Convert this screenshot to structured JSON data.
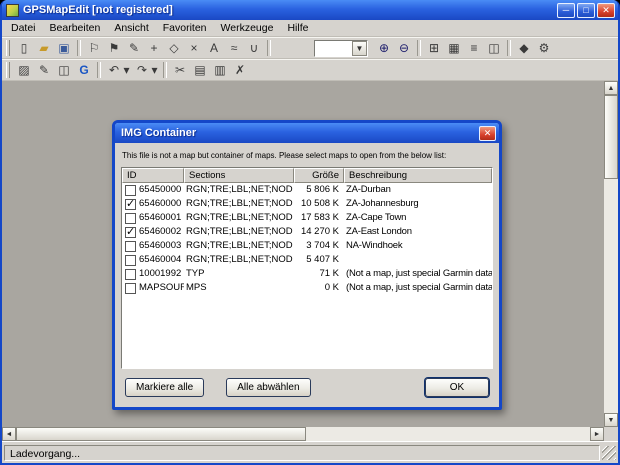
{
  "window": {
    "title": "GPSMapEdit [not registered]",
    "min_glyph": "─",
    "max_glyph": "□",
    "close_glyph": "✕"
  },
  "menubar": {
    "items": [
      "Datei",
      "Bearbeiten",
      "Ansicht",
      "Favoriten",
      "Werkzeuge",
      "Hilfe"
    ]
  },
  "toolbars": {
    "row1a": [
      {
        "name": "new-file-icon",
        "glyph": "▯"
      },
      {
        "name": "open-file-icon",
        "glyph": "▰"
      },
      {
        "name": "save-icon",
        "glyph": "▣"
      },
      {
        "name": "separator",
        "glyph": ""
      },
      {
        "name": "add-waypoint-icon",
        "glyph": "⚐"
      },
      {
        "name": "add-flag-icon",
        "glyph": "⚑"
      },
      {
        "name": "draw-polyline-icon",
        "glyph": "✎"
      },
      {
        "name": "add-node-icon",
        "glyph": "+"
      },
      {
        "name": "move-vertex-icon",
        "glyph": "◇"
      },
      {
        "name": "erase-icon",
        "glyph": "×"
      },
      {
        "name": "label-icon",
        "glyph": "A"
      },
      {
        "name": "route-icon",
        "glyph": "≈"
      },
      {
        "name": "magnet-icon",
        "glyph": "∪"
      },
      {
        "name": "separator",
        "glyph": ""
      }
    ],
    "scale_combo_value": "",
    "row1b": [
      {
        "name": "zoom-in-icon",
        "glyph": "⊕"
      },
      {
        "name": "zoom-out-icon",
        "glyph": "⊖"
      },
      {
        "name": "separator",
        "glyph": ""
      },
      {
        "name": "grid-icon",
        "glyph": "⊞"
      },
      {
        "name": "mesh-icon",
        "glyph": "▦"
      },
      {
        "name": "layers-icon",
        "glyph": "≡"
      },
      {
        "name": "tiles-icon",
        "glyph": "◫"
      },
      {
        "name": "separator",
        "glyph": ""
      },
      {
        "name": "objects-icon",
        "glyph": "◆"
      },
      {
        "name": "settings-icon",
        "glyph": "⚙"
      }
    ],
    "row2": [
      {
        "name": "hatch-icon",
        "glyph": "▨"
      },
      {
        "name": "pencil-icon",
        "glyph": "✎"
      },
      {
        "name": "overlay-icon",
        "glyph": "◫"
      },
      {
        "name": "google-earth-icon",
        "glyph": "G"
      },
      {
        "name": "separator",
        "glyph": ""
      },
      {
        "name": "undo-icon",
        "glyph": "↶"
      },
      {
        "name": "undo-menu-icon",
        "glyph": "▾"
      },
      {
        "name": "redo-icon",
        "glyph": "↷"
      },
      {
        "name": "redo-menu-icon",
        "glyph": "▾"
      },
      {
        "name": "separator",
        "glyph": ""
      },
      {
        "name": "cut-icon",
        "glyph": "✂"
      },
      {
        "name": "copy-icon",
        "glyph": "▤"
      },
      {
        "name": "paste-icon",
        "glyph": "▥"
      },
      {
        "name": "delete-icon",
        "glyph": "✗"
      }
    ]
  },
  "dialog": {
    "title": "IMG Container",
    "close_glyph": "✕",
    "message": "This file is not a map but container of maps. Please select maps to open from the below list:",
    "list": {
      "columns": [
        "ID",
        "Sections",
        "Größe",
        "Beschreibung"
      ],
      "rows": [
        {
          "checked": false,
          "id": "65450000",
          "sections": "RGN;TRE;LBL;NET;NOD",
          "size": "5 806 K",
          "desc": "ZA-Durban"
        },
        {
          "checked": true,
          "id": "65460000",
          "sections": "RGN;TRE;LBL;NET;NOD",
          "size": "10 508 K",
          "desc": "ZA-Johannesburg"
        },
        {
          "checked": false,
          "id": "65460001",
          "sections": "RGN;TRE;LBL;NET;NOD",
          "size": "17 583 K",
          "desc": "ZA-Cape Town"
        },
        {
          "checked": true,
          "id": "65460002",
          "sections": "RGN;TRE;LBL;NET;NOD",
          "size": "14 270 K",
          "desc": "ZA-East London"
        },
        {
          "checked": false,
          "id": "65460003",
          "sections": "RGN;TRE;LBL;NET;NOD",
          "size": "3 704 K",
          "desc": "NA-Windhoek"
        },
        {
          "checked": false,
          "id": "65460004",
          "sections": "RGN;TRE;LBL;NET;NOD",
          "size": "5 407 K",
          "desc": ""
        },
        {
          "checked": false,
          "id": "10001992",
          "sections": "TYP",
          "size": "71 K",
          "desc": "(Not a map, just special Garmin data)"
        },
        {
          "checked": false,
          "id": "MAPSOURC",
          "sections": "MPS",
          "size": "0 K",
          "desc": "(Not a map, just special Garmin data)"
        }
      ]
    },
    "buttons": {
      "select_all": "Markiere alle",
      "deselect_all": "Alle abwählen",
      "ok": "OK"
    }
  },
  "statusbar": {
    "text": "Ladevorgang..."
  },
  "colors": {
    "titlebar_top": "#4a8cf5",
    "titlebar_mid": "#2a62e0",
    "titlebar_bottom": "#1a48c4",
    "window_border": "#1447c8",
    "close_red": "#d8402c",
    "canvas_gray": "#a9a6a0"
  }
}
